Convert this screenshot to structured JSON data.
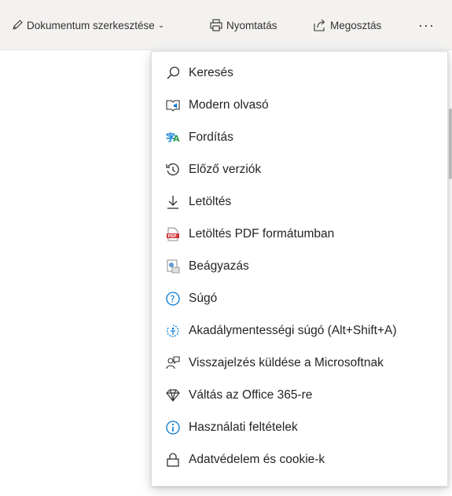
{
  "toolbar": {
    "edit_label": "Dokumentum szerkesztése",
    "print_label": "Nyomtatás",
    "share_label": "Megosztás",
    "more_label": "···"
  },
  "menu": {
    "items": [
      {
        "label": "Keresés",
        "icon": "search-icon"
      },
      {
        "label": "Modern olvasó",
        "icon": "immersive-reader-icon"
      },
      {
        "label": "Fordítás",
        "icon": "translate-icon"
      },
      {
        "label": "Előző verziók",
        "icon": "history-icon"
      },
      {
        "label": "Letöltés",
        "icon": "download-icon"
      },
      {
        "label": "Letöltés PDF formátumban",
        "icon": "pdf-icon"
      },
      {
        "label": "Beágyazás",
        "icon": "embed-icon"
      },
      {
        "label": "Súgó",
        "icon": "help-icon"
      },
      {
        "label": "Akadálymentességi súgó (Alt+Shift+A)",
        "icon": "accessibility-icon"
      },
      {
        "label": "Visszajelzés küldése a Microsoftnak",
        "icon": "feedback-icon"
      },
      {
        "label": "Váltás az Office 365-re",
        "icon": "diamond-icon"
      },
      {
        "label": "Használati feltételek",
        "icon": "info-icon"
      },
      {
        "label": "Adatvédelem és cookie-k",
        "icon": "lock-icon"
      }
    ]
  },
  "colors": {
    "accent_blue": "#0078d4",
    "pdf_red": "#d13438",
    "translate_green": "#2e9e4f"
  }
}
